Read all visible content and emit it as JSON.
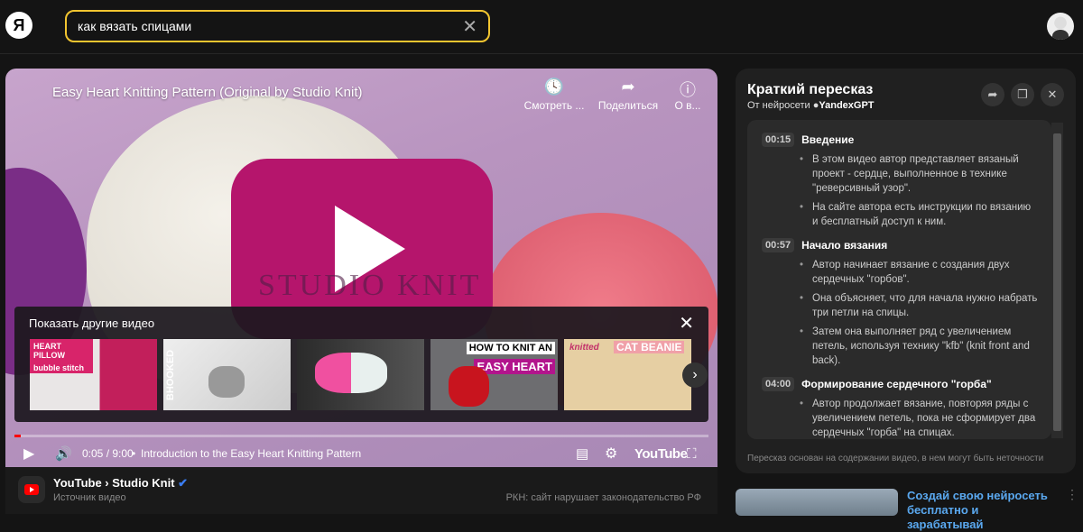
{
  "header": {
    "logo": "Я",
    "search_value": "как вязать спицами",
    "clear_icon": "close-icon"
  },
  "video": {
    "title": "Easy Heart Knitting Pattern (Original by Studio Knit)",
    "watermark": "Studio Knit",
    "actions": [
      {
        "icon": "clock-icon",
        "label": "Смотреть ..."
      },
      {
        "icon": "share-icon",
        "label": "Поделиться"
      },
      {
        "icon": "info-icon",
        "label": "О в..."
      }
    ],
    "more_videos": {
      "title": "Показать другие видео",
      "thumbnails": [
        {
          "line1": "HEART PILLOW",
          "line2": "bubble stitch"
        },
        {
          "line1": "BHOOKED",
          "line2": ""
        },
        {
          "line1": "",
          "line2": ""
        },
        {
          "line1": "HOW TO KNIT AN",
          "line2": "EASY HEART"
        },
        {
          "line1": "knitted",
          "line2": "CAT BEANIE"
        }
      ]
    },
    "progress_percent": 0.9,
    "time": "0:05 / 9:00",
    "chapter": "Introduction to the Easy Heart Knitting Pattern",
    "youtube_label": "YouTube"
  },
  "source": {
    "channel": "YouTube › Studio Knit",
    "subtitle": "Источник видео",
    "notice": "РКН: сайт нарушает законодательство РФ"
  },
  "panel": {
    "title": "Краткий пересказ",
    "subtitle_prefix": "От нейросети",
    "subtitle_brand": "YandexGPT",
    "sections": [
      {
        "time": "00:15",
        "title": "Введение",
        "points": [
          "В этом видео автор представляет вязаный проект - сердце, выполненное в технике \"реверсивный узор\".",
          "На сайте автора есть инструкции по вязанию и бесплатный доступ к ним."
        ]
      },
      {
        "time": "00:57",
        "title": "Начало вязания",
        "points": [
          "Автор начинает вязание с создания двух сердечных \"горбов\".",
          "Она объясняет, что для начала нужно набрать три петли на спицы.",
          "Затем она выполняет ряд с увеличением петель, используя технику \"kfb\" (knit front and back)."
        ]
      },
      {
        "time": "04:00",
        "title": "Формирование сердечного \"горба\"",
        "points": [
          "Автор продолжает вязание, повторяя ряды с увеличением петель, пока не сформирует два сердечных \"горба\" на спицах."
        ]
      }
    ],
    "footer": "Пересказ основан на содержании видео, в нем могут быть неточности"
  },
  "ad": {
    "text": "Создай свою нейросеть бесплатно и зарабатывай"
  }
}
